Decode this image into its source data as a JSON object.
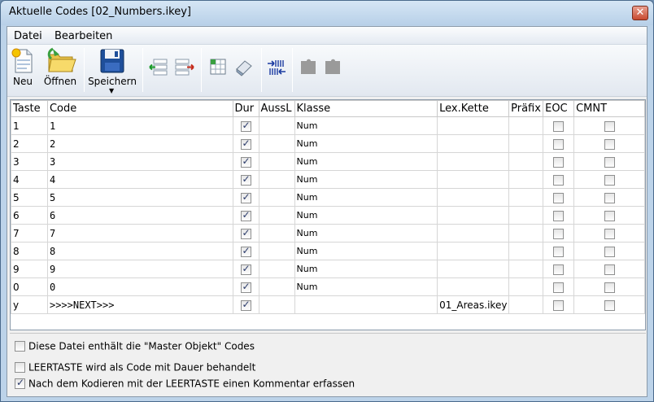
{
  "window": {
    "title": "Aktuelle Codes [02_Numbers.ikey]",
    "close_glyph": "✕"
  },
  "menu": [
    "Datei",
    "Bearbeiten"
  ],
  "toolbar": {
    "new_label": "Neu",
    "open_label": "Öffnen",
    "save_label": "Speichern"
  },
  "columns": [
    "Taste",
    "Code",
    "Dur",
    "AussL",
    "Klasse",
    "Lex.Kette",
    "Präfix",
    "EOC",
    "CMNT"
  ],
  "rows": [
    {
      "taste": "1",
      "code": "1",
      "dur": true,
      "aussl": "",
      "klasse": "Num",
      "lex": "",
      "praefix": "",
      "eoc": false,
      "cmnt": false
    },
    {
      "taste": "2",
      "code": "2",
      "dur": true,
      "aussl": "",
      "klasse": "Num",
      "lex": "",
      "praefix": "",
      "eoc": false,
      "cmnt": false
    },
    {
      "taste": "3",
      "code": "3",
      "dur": true,
      "aussl": "",
      "klasse": "Num",
      "lex": "",
      "praefix": "",
      "eoc": false,
      "cmnt": false
    },
    {
      "taste": "4",
      "code": "4",
      "dur": true,
      "aussl": "",
      "klasse": "Num",
      "lex": "",
      "praefix": "",
      "eoc": false,
      "cmnt": false
    },
    {
      "taste": "5",
      "code": "5",
      "dur": true,
      "aussl": "",
      "klasse": "Num",
      "lex": "",
      "praefix": "",
      "eoc": false,
      "cmnt": false
    },
    {
      "taste": "6",
      "code": "6",
      "dur": true,
      "aussl": "",
      "klasse": "Num",
      "lex": "",
      "praefix": "",
      "eoc": false,
      "cmnt": false
    },
    {
      "taste": "7",
      "code": "7",
      "dur": true,
      "aussl": "",
      "klasse": "Num",
      "lex": "",
      "praefix": "",
      "eoc": false,
      "cmnt": false
    },
    {
      "taste": "8",
      "code": "8",
      "dur": true,
      "aussl": "",
      "klasse": "Num",
      "lex": "",
      "praefix": "",
      "eoc": false,
      "cmnt": false
    },
    {
      "taste": "9",
      "code": "9",
      "dur": true,
      "aussl": "",
      "klasse": "Num",
      "lex": "",
      "praefix": "",
      "eoc": false,
      "cmnt": false
    },
    {
      "taste": "0",
      "code": "0",
      "dur": true,
      "aussl": "",
      "klasse": "Num",
      "lex": "",
      "praefix": "",
      "eoc": false,
      "cmnt": false
    },
    {
      "taste": "y",
      "code": ">>>>NEXT>>>",
      "dur": true,
      "aussl": "",
      "klasse": "",
      "lex": "01_Areas.ikey",
      "praefix": "",
      "eoc": false,
      "cmnt": false
    }
  ],
  "options": [
    {
      "label": "Diese Datei enthält die \"Master Objekt\" Codes",
      "checked": false
    },
    {
      "label": "LEERTASTE wird als Code mit Dauer behandelt",
      "checked": false
    },
    {
      "label": "Nach dem Kodieren mit der LEERTASTE einen Kommentar erfassen",
      "checked": true
    }
  ]
}
